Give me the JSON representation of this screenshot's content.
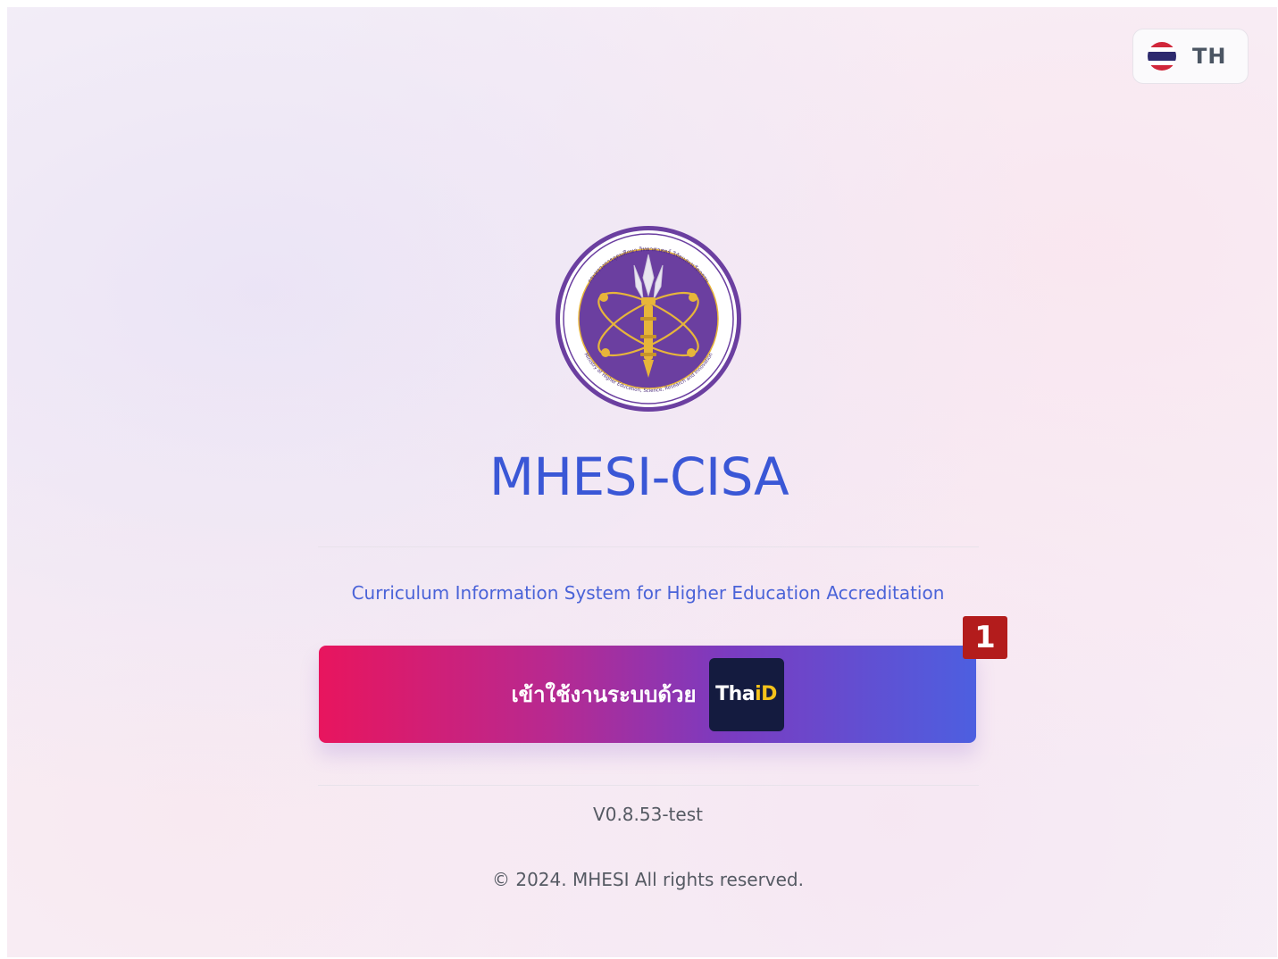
{
  "language_switcher": {
    "label": "TH",
    "flag_icon": "thai-flag-icon"
  },
  "branding": {
    "logo_icon": "mhesi-seal-logo",
    "seal_text_top": "กระทรวงการอุดมศึกษา วิทยาศาสตร์ วิจัยและนวัตกรรม",
    "seal_text_bottom": "Ministry of Higher Education, Science, Research and Innovation",
    "title": "MHESI-CISA",
    "subtitle": "Curriculum Information System for Higher Education Accreditation"
  },
  "login": {
    "label": "เข้าใช้งานระบบด้วย",
    "provider_tha": "Tha",
    "provider_id": "iD",
    "marker": "1"
  },
  "footer": {
    "version": "V0.8.53-test",
    "copyright": "© 2024. MHESI All rights reserved."
  },
  "colors": {
    "title": "#3a57d6",
    "subtitle": "#4a63d8",
    "button_gradient_start": "#e8155e",
    "button_gradient_end": "#4d5fe0",
    "marker": "#b31c1c",
    "seal_purple": "#6b3fa0",
    "seal_gold": "#e7b53a"
  }
}
